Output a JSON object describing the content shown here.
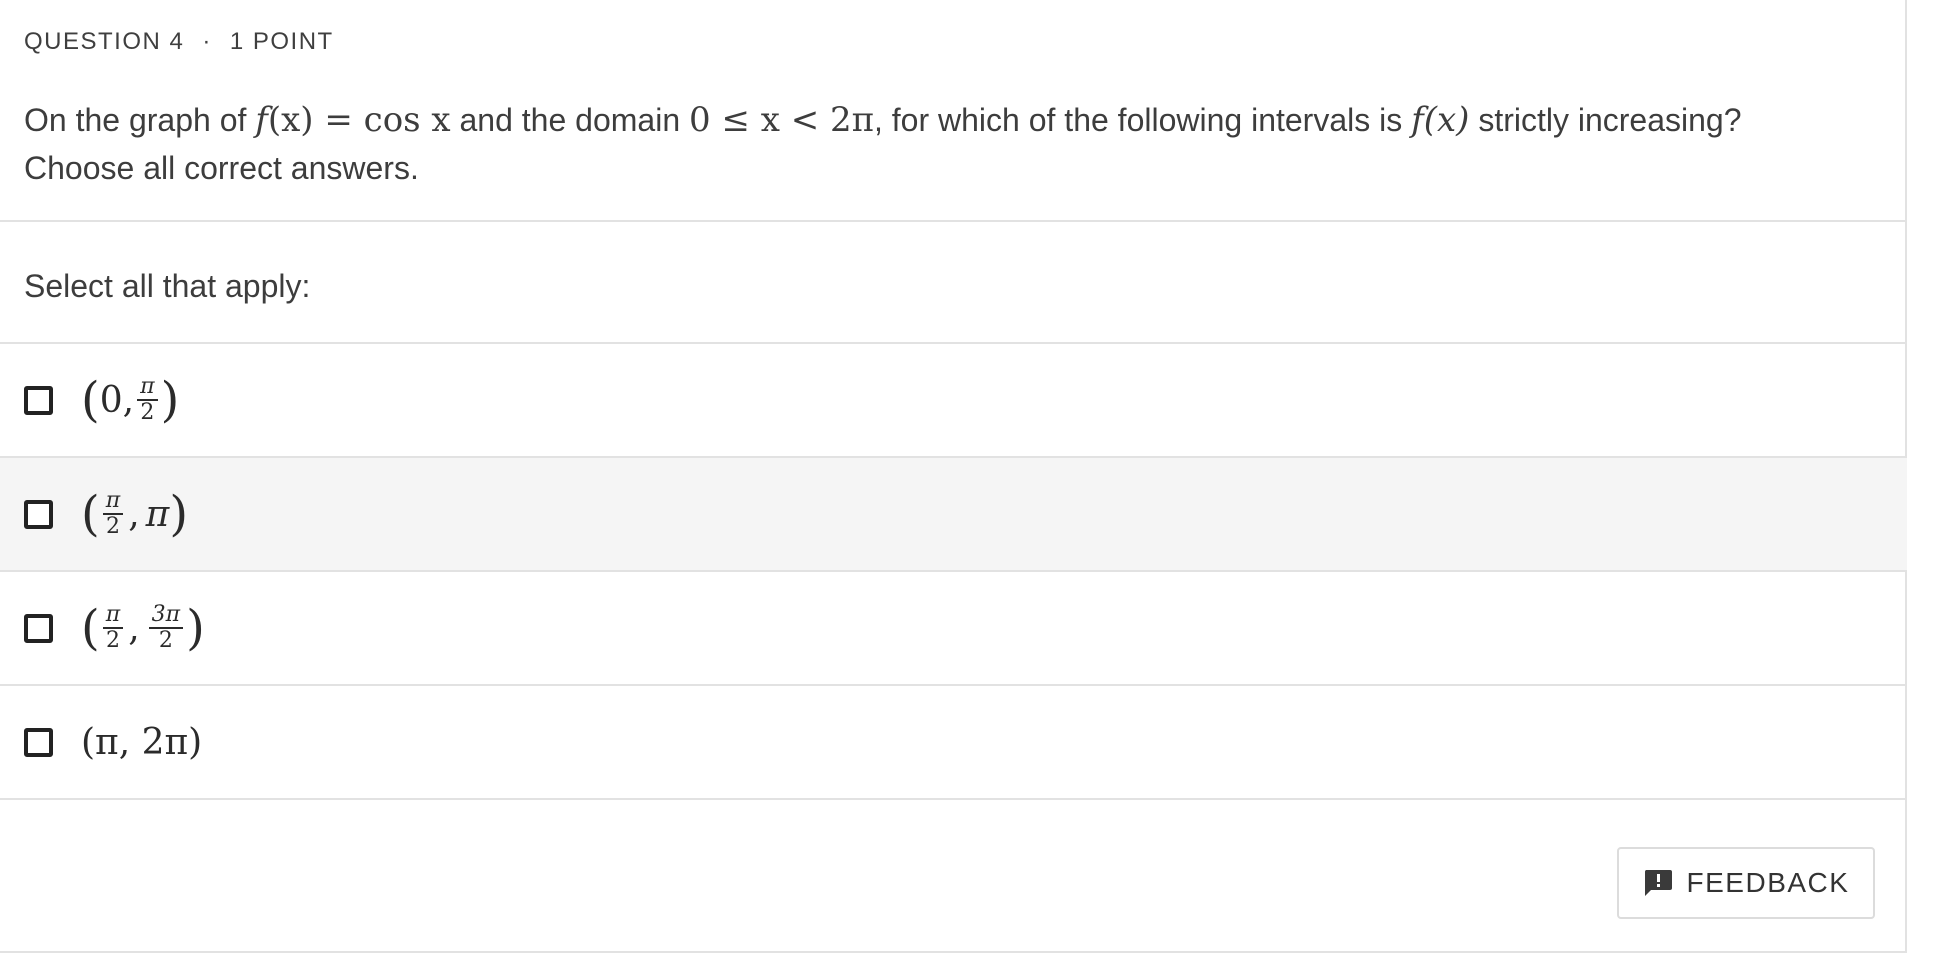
{
  "question": {
    "number_label": "QUESTION 4",
    "separator": "·",
    "points_label": "1 POINT",
    "prompt_parts": {
      "t1": "On the graph of ",
      "func": "f",
      "eq": "(x) = cos x",
      "t2": " and the domain ",
      "domain": "0 ≤ x < 2π",
      "t3": ", for which of the following intervals is ",
      "func2": "f(x)",
      "t4": " strictly increasing?"
    },
    "instruction": "Choose all correct answers."
  },
  "select_label": "Select all that apply:",
  "options": [
    {
      "left": "(0,",
      "num": "π",
      "den": "2",
      "right": ")",
      "checked": false
    },
    {
      "left_paren": "(",
      "num": "π",
      "den": "2",
      "right": ", π)",
      "checked": false
    },
    {
      "left_paren": "(",
      "num1": "π",
      "den1": "2",
      "num2": "3π",
      "den2": "2",
      "right": ")",
      "checked": false
    },
    {
      "text": "(π, 2π)",
      "checked": false
    }
  ],
  "feedback": {
    "label": "FEEDBACK",
    "icon": "feedback-icon"
  }
}
